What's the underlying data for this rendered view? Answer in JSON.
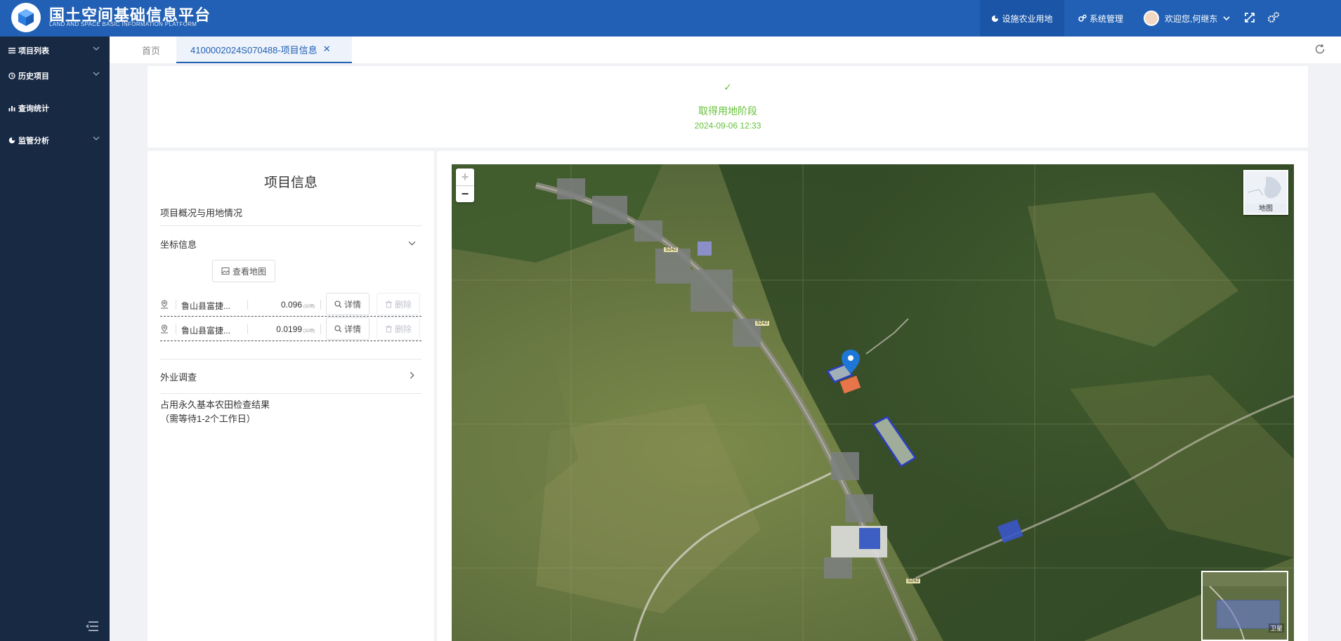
{
  "header": {
    "title": "国土空间基础信息平台",
    "subtitle": "LAND AND SPACE BASIC INFORMATION PLATFORM",
    "nav_active": "设施农业用地",
    "nav_system": "系统管理",
    "user_greeting": "欢迎您,何继东"
  },
  "sidebar": {
    "items": [
      {
        "label": "项目列表",
        "icon": "list-icon",
        "has_chevron": true
      },
      {
        "label": "历史项目",
        "icon": "history-icon",
        "has_chevron": true
      },
      {
        "label": "查询统计",
        "icon": "bar-chart-icon",
        "has_chevron": false
      },
      {
        "label": "监管分析",
        "icon": "pie-chart-icon",
        "has_chevron": true
      }
    ]
  },
  "tabs": {
    "home": "首页",
    "active": "4100002024S070488-项目信息"
  },
  "stage": {
    "label": "取得用地阶段",
    "date": "2024-09-06 12:33",
    "status_color": "#67c23a"
  },
  "project": {
    "title": "项目信息",
    "section_overview": "项目概况与用地情况",
    "section_coords": "坐标信息",
    "view_map_label": "查看地图",
    "coords": [
      {
        "name": "鲁山县富捷...",
        "area": "0.096",
        "unit": "(公顷)",
        "detail": "详情",
        "delete": "删除"
      },
      {
        "name": "鲁山县富捷...",
        "area": "0.0199",
        "unit": "(公顷)",
        "detail": "详情",
        "delete": "删除"
      }
    ],
    "section_field": "外业调查",
    "check_title": "占用永久基本农田检查结果",
    "check_note": "（需等待1-2个工作日）"
  },
  "map": {
    "zoom_in": "+",
    "zoom_out": "−",
    "basemap_label": "地图",
    "overview_label": "卫星",
    "road_labels": [
      "S242",
      "S242",
      "S242"
    ]
  },
  "colors": {
    "header_bg": "#2160b4",
    "sidebar_bg": "#182944",
    "accent": "#2160b4",
    "success": "#67c23a"
  }
}
